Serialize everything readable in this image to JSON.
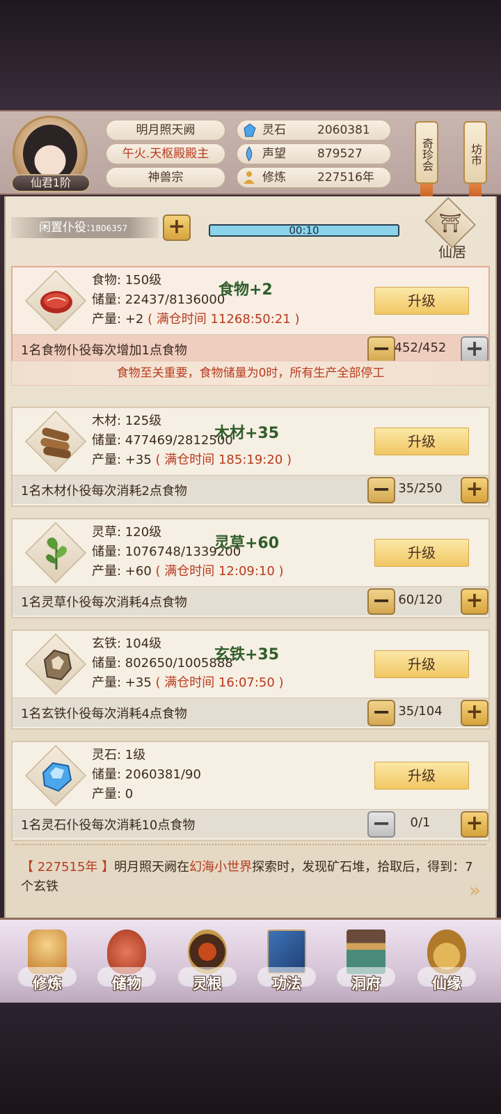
{
  "player": {
    "rank": "仙君1阶",
    "name": "明月照天阙",
    "title": "午火.天枢殿殿主",
    "sect": "神兽宗"
  },
  "resources_top": [
    {
      "icon": "spirit-stone-icon",
      "label": "灵石",
      "value": "2060381"
    },
    {
      "icon": "reputation-icon",
      "label": "声望",
      "value": "879527"
    },
    {
      "icon": "cultivation-icon",
      "label": "修炼",
      "value": "227516年"
    }
  ],
  "banners": {
    "qizhen": "奇珍会",
    "fangshi": "坊市"
  },
  "idle": {
    "label": "闲置仆役:",
    "value": "1806357",
    "timer": "00:10"
  },
  "xianju": {
    "label": "仙居"
  },
  "cards": [
    {
      "name": "食物: 150级",
      "store": "储量: 22437/8136000",
      "prod_prefix": "产量: +2",
      "prod_full": "( 满仓时间 11268:50:21 )",
      "float": "食物+2",
      "upgrade": "升级",
      "desc": "1名食物仆役每次增加1点食物",
      "count": "452/452"
    },
    {
      "name": "木材: 125级",
      "store": "储量: 477469/2812500",
      "prod_prefix": "产量: +35",
      "prod_full": "( 满仓时间 185:19:20 )",
      "float": "木材+35",
      "upgrade": "升级",
      "desc": "1名木材仆役每次消耗2点食物",
      "count": "35/250"
    },
    {
      "name": "灵草: 120级",
      "store": "储量: 1076748/1339200",
      "prod_prefix": "产量: +60",
      "prod_full": "( 满仓时间 12:09:10 )",
      "float": "灵草+60",
      "upgrade": "升级",
      "desc": "1名灵草仆役每次消耗4点食物",
      "count": "60/120"
    },
    {
      "name": "玄铁: 104级",
      "store": "储量: 802650/1005888",
      "prod_prefix": "产量: +35",
      "prod_full": "( 满仓时间 16:07:50 )",
      "float": "玄铁+35",
      "upgrade": "升级",
      "desc": "1名玄铁仆役每次消耗4点食物",
      "count": "35/104"
    },
    {
      "name": "灵石: 1级",
      "store": "储量: 2060381/90",
      "prod_prefix": "产量: 0",
      "prod_full": "",
      "float": "",
      "upgrade": "升级",
      "desc": "1名灵石仆役每次消耗10点食物",
      "count": "0/1"
    }
  ],
  "notice": "食物至关重要，食物储量为0时，所有生产全部停工",
  "log": {
    "year": "【 227515年 】",
    "name": "明月照天阙",
    "mid1": "在",
    "place": "幻海小世界",
    "rest": "探索时，发现矿石堆，拾取后，得到：7个玄铁"
  },
  "nav": [
    {
      "label": "修炼",
      "icon": "cultivate-icon"
    },
    {
      "label": "储物",
      "icon": "storage-bag-icon"
    },
    {
      "label": "灵根",
      "icon": "spirit-root-icon"
    },
    {
      "label": "功法",
      "icon": "technique-book-icon"
    },
    {
      "label": "洞府",
      "icon": "cave-mansion-icon"
    },
    {
      "label": "仙缘",
      "icon": "fortune-gourd-icon"
    }
  ],
  "colors": {
    "accent_red": "#b83a1e",
    "gold_button": "#f1c763",
    "float_green": "#2f5d2a",
    "timer_blue": "#8ad3ea"
  }
}
